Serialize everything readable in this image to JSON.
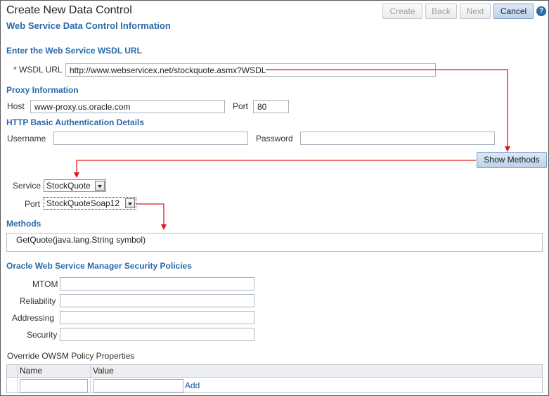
{
  "header": {
    "title": "Create New Data Control",
    "section_title": "Web Service Data Control Information",
    "buttons": {
      "create": "Create",
      "back": "Back",
      "next": "Next",
      "cancel": "Cancel"
    },
    "help_icon": "help-icon"
  },
  "wsdl": {
    "heading": "Enter the Web Service WSDL URL",
    "required_marker": "*",
    "label": "WSDL URL",
    "value": "http://www.webservicex.net/stockquote.asmx?WSDL"
  },
  "proxy": {
    "heading": "Proxy Information",
    "host_label": "Host",
    "host_value": "www-proxy.us.oracle.com",
    "port_label": "Port",
    "port_value": "80"
  },
  "auth": {
    "heading": "HTTP Basic Authentication Details",
    "username_label": "Username",
    "username_value": "",
    "password_label": "Password",
    "password_value": ""
  },
  "show_methods": {
    "label": "Show Methods"
  },
  "service": {
    "label": "Service",
    "selected": "StockQuote"
  },
  "port": {
    "label": "Port",
    "selected": "StockQuoteSoap12"
  },
  "methods": {
    "heading": "Methods",
    "items": [
      "GetQuote(java.lang.String symbol)"
    ]
  },
  "owsm": {
    "heading": "Oracle Web Service Manager Security Policies",
    "fields": [
      {
        "label": "MTOM",
        "value": ""
      },
      {
        "label": "Reliability",
        "value": ""
      },
      {
        "label": "Addressing",
        "value": ""
      },
      {
        "label": "Security",
        "value": ""
      }
    ]
  },
  "override": {
    "label": "Override OWSM Policy Properties",
    "columns": [
      "Name",
      "Value"
    ],
    "add_label": "Add"
  },
  "colors": {
    "heading_blue": "#2a6aa8",
    "arrow_red": "#e0191e",
    "primary_button": "#bcd3ea"
  }
}
